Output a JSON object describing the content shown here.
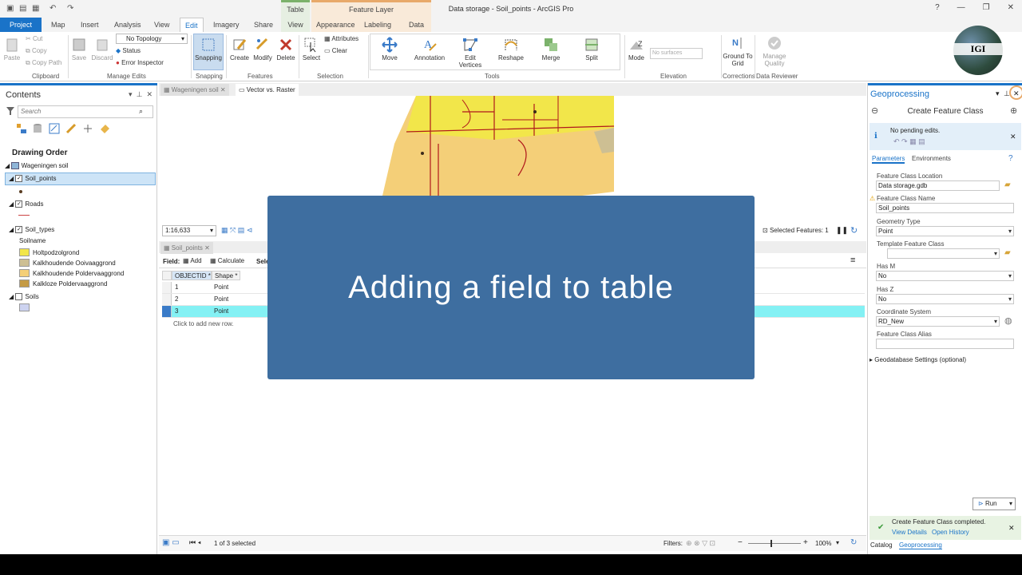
{
  "window": {
    "title": "Data storage - Soil_points - ArcGIS Pro",
    "context_table": "Table",
    "context_feature_layer": "Feature Layer",
    "help": "?"
  },
  "tabs": [
    "Project",
    "Map",
    "Insert",
    "Analysis",
    "View",
    "Edit",
    "Imagery",
    "Share",
    "View",
    "Appearance",
    "Labeling",
    "Data"
  ],
  "ribbon": {
    "clipboard": {
      "paste": "Paste",
      "cut": "Cut",
      "copy": "Copy",
      "copy_path": "Copy Path",
      "label": "Clipboard"
    },
    "manage_edits": {
      "save": "Save",
      "discard": "Discard",
      "topology": "No Topology",
      "status": "Status",
      "error_inspector": "Error Inspector",
      "label": "Manage Edits"
    },
    "snapping": {
      "btn": "Snapping",
      "label": "Snapping"
    },
    "features": {
      "create": "Create",
      "modify": "Modify",
      "delete": "Delete",
      "label": "Features"
    },
    "selection": {
      "select": "Select",
      "attributes": "Attributes",
      "clear": "Clear",
      "label": "Selection"
    },
    "tools": {
      "move": "Move",
      "annotation": "Annotation",
      "edit_vertices": "Edit Vertices",
      "reshape": "Reshape",
      "merge": "Merge",
      "split": "Split",
      "label": "Tools"
    },
    "elevation": {
      "mode": "Mode",
      "surfaces": "No surfaces",
      "label": "Elevation"
    },
    "corrections": {
      "ground": "Ground To Grid",
      "label": "Corrections"
    },
    "data_reviewer": {
      "manage": "Manage Quality",
      "label": "Data Reviewer"
    }
  },
  "logo_text": "IGI",
  "contents": {
    "title": "Contents",
    "search_placeholder": "Search",
    "drawing_order": "Drawing Order",
    "map_name": "Wageningen soil",
    "layers": [
      "Soil_points",
      "Roads",
      "Soil_types",
      "Soils"
    ],
    "field_name": "Soilname",
    "legend": [
      {
        "label": "Holtpodzolgrond",
        "color": "#f2e64a"
      },
      {
        "label": "Kalkhoudende Ooivaaggrond",
        "color": "#cdbf93"
      },
      {
        "label": "Kalkhoudende Poldervaaggrond",
        "color": "#f4cf78"
      },
      {
        "label": "Kalkloze Poldervaaggrond",
        "color": "#c49a43"
      }
    ],
    "soils_swatch": "#cdd3f0"
  },
  "views": {
    "tab1": "Wageningen soil",
    "tab2": "Vector vs. Raster"
  },
  "map_status": {
    "scale": "1:16,633",
    "selected": "Selected Features: 1"
  },
  "table": {
    "tab": "Soil_points",
    "field_label": "Field:",
    "add": "Add",
    "calculate": "Calculate",
    "selection": "Selec",
    "columns": [
      "OBJECTID *",
      "Shape *"
    ],
    "rows": [
      {
        "id": "1",
        "shape": "Point"
      },
      {
        "id": "2",
        "shape": "Point"
      },
      {
        "id": "3",
        "shape": "Point"
      }
    ],
    "add_row": "Click to add new row.",
    "status": "1 of 3 selected",
    "filters": "Filters:",
    "zoom": "100%"
  },
  "overlay_text": "Adding a field to table",
  "geo": {
    "title": "Geoprocessing",
    "tool": "Create Feature Class",
    "pending": "No pending edits.",
    "tab_params": "Parameters",
    "tab_env": "Environments",
    "fields": [
      {
        "label": "Feature Class Location",
        "value": "Data storage.gdb"
      },
      {
        "label": "Feature Class Name",
        "value": "Soil_points"
      },
      {
        "label": "Geometry Type",
        "value": "Point"
      },
      {
        "label": "Template Feature Class",
        "value": ""
      },
      {
        "label": "Has M",
        "value": "No"
      },
      {
        "label": "Has Z",
        "value": "No"
      },
      {
        "label": "Coordinate System",
        "value": "RD_New"
      },
      {
        "label": "Feature Class Alias",
        "value": ""
      }
    ],
    "gdb_settings": "Geodatabase Settings (optional)",
    "run": "Run",
    "completed": "Create Feature Class completed.",
    "view_details": "View Details",
    "open_history": "Open History",
    "bottom_catalog": "Catalog",
    "bottom_geo": "Geoprocessing"
  }
}
